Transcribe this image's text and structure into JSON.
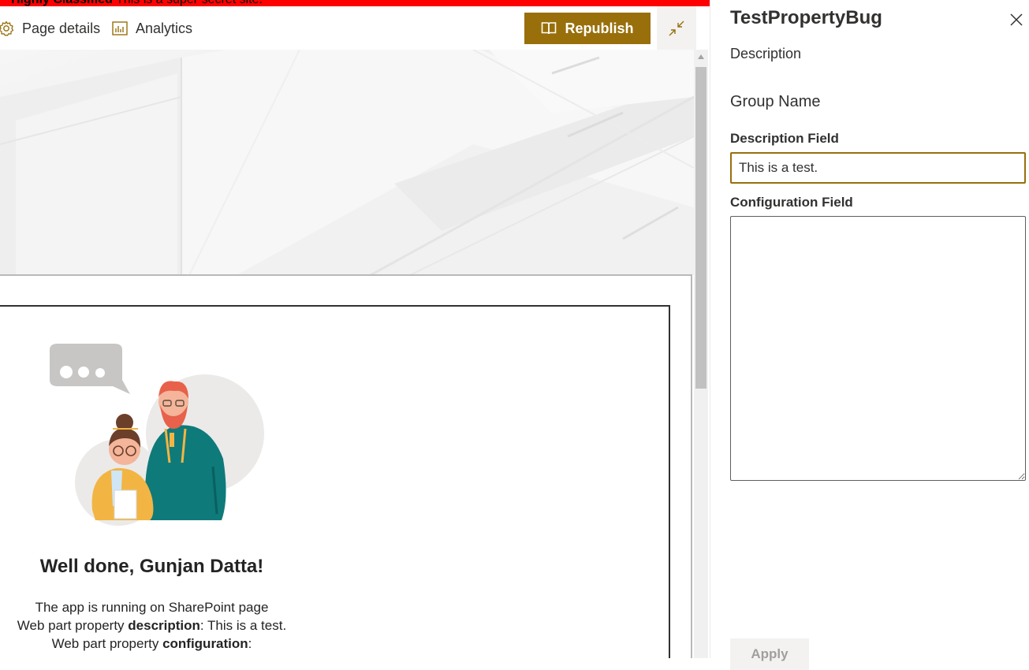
{
  "banner": {
    "label": "Highly Classified",
    "text": "This is a super secret site."
  },
  "toolbar": {
    "page_details": "Page details",
    "analytics": "Analytics",
    "republish": "Republish"
  },
  "webpart": {
    "heading": "Well done, Gunjan Datta!",
    "line1": "The app is running on SharePoint page",
    "line2_prefix": "Web part property ",
    "line2_bold": "description",
    "line2_suffix": ": This is a test.",
    "line3_prefix": "Web part property ",
    "line3_bold": "configuration",
    "line3_suffix": ":"
  },
  "pane": {
    "title": "TestPropertyBug",
    "description": "Description",
    "group_name": "Group Name",
    "description_field": {
      "label": "Description Field",
      "value": "This is a test."
    },
    "configuration_field": {
      "label": "Configuration Field",
      "value": ""
    },
    "apply": "Apply"
  },
  "colors": {
    "banner": "#ff0000",
    "accent": "#986f0b",
    "teal": "#0f7a7a",
    "mustard": "#f2b544"
  }
}
